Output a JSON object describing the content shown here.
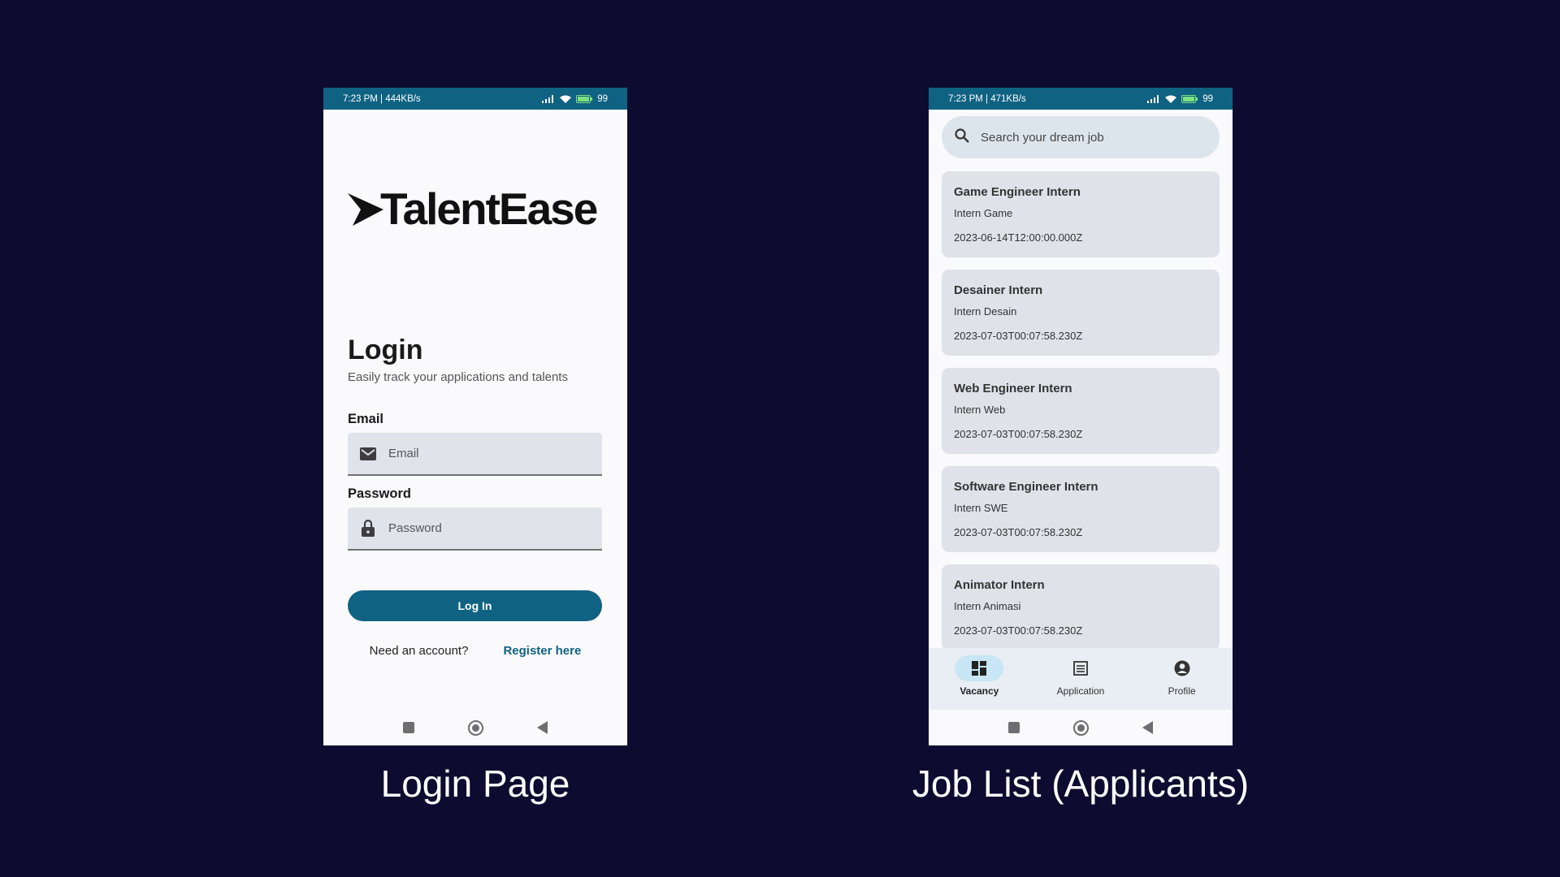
{
  "login_screen": {
    "status": {
      "time": "7:23 PM | 444KB/s",
      "battery": "99"
    },
    "logo_text": "TalentEase",
    "title": "Login",
    "subtitle": "Easily track your applications and talents",
    "email_label": "Email",
    "email_placeholder": "Email",
    "password_label": "Password",
    "password_placeholder": "Password",
    "login_button": "Log In",
    "register_question": "Need an account?",
    "register_link": "Register here"
  },
  "jobs_screen": {
    "status": {
      "time": "7:23 PM | 471KB/s",
      "battery": "99"
    },
    "search_placeholder": "Search your dream job",
    "jobs": [
      {
        "title": "Game Engineer Intern",
        "subtitle": "Intern Game",
        "date": "2023-06-14T12:00:00.000Z"
      },
      {
        "title": "Desainer Intern",
        "subtitle": "Intern Desain",
        "date": "2023-07-03T00:07:58.230Z"
      },
      {
        "title": "Web Engineer Intern",
        "subtitle": "Intern Web",
        "date": "2023-07-03T00:07:58.230Z"
      },
      {
        "title": "Software Engineer Intern",
        "subtitle": "Intern SWE",
        "date": "2023-07-03T00:07:58.230Z"
      },
      {
        "title": "Animator Intern",
        "subtitle": "Intern Animasi",
        "date": "2023-07-03T00:07:58.230Z"
      }
    ],
    "nav": [
      {
        "label": "Vacancy",
        "icon": "dashboard-icon",
        "active": true
      },
      {
        "label": "Application",
        "icon": "list-icon",
        "active": false
      },
      {
        "label": "Profile",
        "icon": "account-circle-icon",
        "active": false
      }
    ]
  },
  "captions": {
    "login": "Login Page",
    "jobs": "Job List (Applicants)"
  },
  "colors": {
    "background": "#0e0b30",
    "primary": "#0f6282",
    "card": "#dfe2e8",
    "active_nav_pill": "#c8e6f5"
  }
}
